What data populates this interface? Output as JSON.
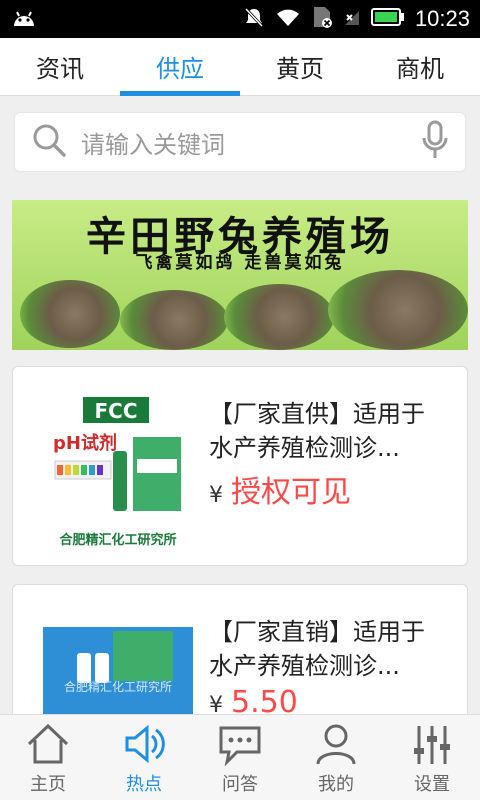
{
  "status": {
    "time": "10:23"
  },
  "tabs": [
    "资讯",
    "供应",
    "黄页",
    "商机"
  ],
  "search": {
    "placeholder": "请输入关键词"
  },
  "banner": {
    "title": "辛田野兔养殖场",
    "subtitle": "飞禽莫如鸪  走兽莫如兔"
  },
  "products": [
    {
      "title": "【厂家直供】适用于水产养殖检测诊...",
      "price": "授权可见",
      "brand": "FCC",
      "label": "pH试剂",
      "maker": "合肥精汇化工研究所"
    },
    {
      "title": "【厂家直销】适用于水产养殖检测诊...",
      "price": "5.50",
      "watermark": "合肥精汇化工研究所"
    }
  ],
  "currency": "¥",
  "nav": [
    "主页",
    "热点",
    "问答",
    "我的",
    "设置"
  ],
  "colors": {
    "accent": "#1f8fe0",
    "price": "#ff4949"
  }
}
